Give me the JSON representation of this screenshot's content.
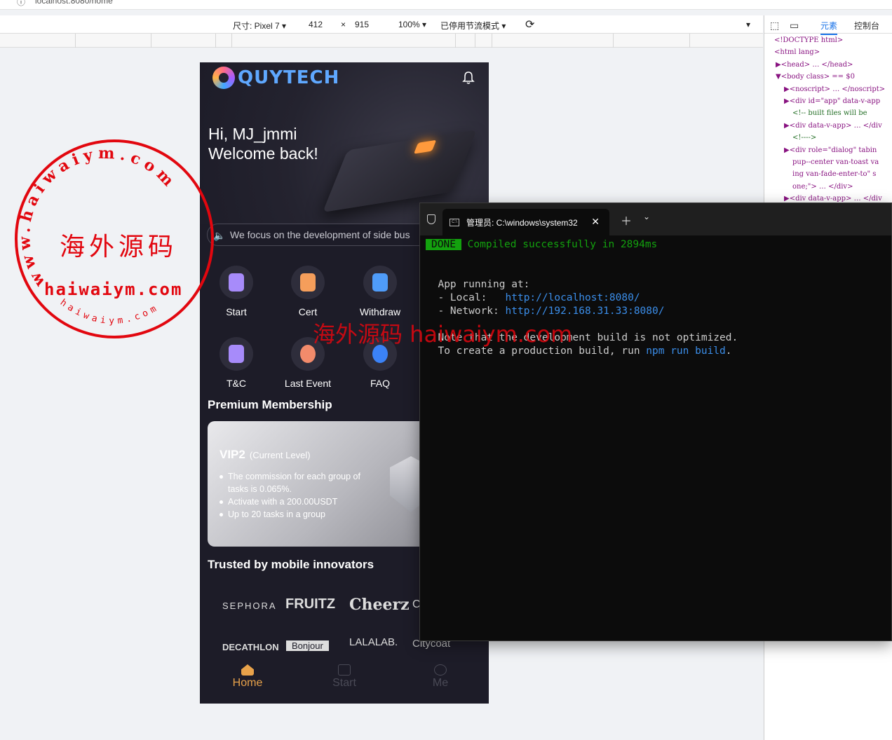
{
  "browser": {
    "url": "localhost:8080/home"
  },
  "devtools_toolbar": {
    "size_label": "尺寸: Pixel 7",
    "width": "412",
    "times": "×",
    "height": "915",
    "zoom": "100%",
    "throttle": "已停用节流模式"
  },
  "devtools_panel": {
    "tab_elements": "元素",
    "tab_console": "控制台",
    "lines": [
      "<!DOCTYPE html>",
      "<html lang>",
      "▶<head> … </head>",
      "▼<body class> == $0",
      "▶<noscript> … </noscript>",
      "▶<div id=\"app\" data-v-app",
      "<!-- built files will be",
      "▶<div data-v-app> … </div",
      "<!---->",
      "▶<div role=\"dialog\" tabin",
      "pup--center van-toast va",
      "ing van-fade-enter-to\" s",
      "one;\"> … </div>",
      "▶<div data-v-app> … </div"
    ]
  },
  "app": {
    "logo_text": "QUYTECH",
    "greeting_line1": "Hi, MJ_jmmi",
    "greeting_line2": "Welcome back!",
    "notice": "We focus on the development of side bus",
    "menu": [
      {
        "label": "Start",
        "icon": "start-icon",
        "color": "#a78bfa"
      },
      {
        "label": "Cert",
        "icon": "cert-icon",
        "color": "#f59e5b"
      },
      {
        "label": "Withdraw",
        "icon": "withdraw-icon",
        "color": "#4f9cf9"
      },
      {
        "label": "T&C",
        "icon": "terms-icon",
        "color": "#a78bfa"
      },
      {
        "label": "Last Event",
        "icon": "event-icon",
        "color": "#f28b6b"
      },
      {
        "label": "FAQ",
        "icon": "faq-icon",
        "color": "#3b82f6"
      }
    ],
    "premium_title": "Premium Membership",
    "vip": {
      "level": "VIP2",
      "current": "(Current Level)",
      "bullets": [
        "The commission for each group of tasks is 0.065%.",
        "Activate with a 200.00USDT",
        "Up to 20 tasks in a group"
      ]
    },
    "trusted_title": "Trusted by mobile innovators",
    "brands_row1": [
      "SEPHORA",
      "FRUITZ",
      "Cheerz",
      "C"
    ],
    "brands_row2": [
      "DECATHLON",
      "Bonjour",
      "LALALAB.",
      "Citycoat"
    ],
    "tabs": [
      {
        "label": "Home",
        "active": true
      },
      {
        "label": "Start",
        "active": false
      },
      {
        "label": "Me",
        "active": false
      }
    ],
    "accent_color": "#e8a24a"
  },
  "terminal": {
    "tab_title": "管理员: C:\\windows\\system32",
    "done_badge": "DONE",
    "compiled": "Compiled successfully in 2894ms",
    "app_running": "App running at:",
    "local_label": "- Local:   ",
    "local_url": "http://localhost:8080/",
    "network_label": "- Network: ",
    "network_url": "http://192.168.31.33:8080/",
    "note": "Note that the development build is not optimized.",
    "create_prefix": "To create a production build, run ",
    "create_cmd": "npm run build",
    "create_suffix": "."
  },
  "watermark": {
    "stamp_ring": "www.haiwaiym.com",
    "stamp_cn": "海外源码",
    "stamp_domain": "haiwaiym.com",
    "stamp_bottom": "haiwaiym.com",
    "overlay": "海外源码 haiwaiym.com"
  }
}
